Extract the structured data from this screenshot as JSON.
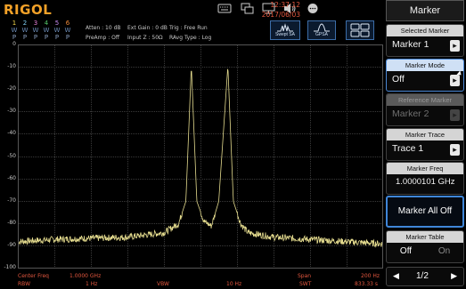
{
  "brand": "RIGOL",
  "traces": [
    {
      "num": "1",
      "color": "#f2d54a",
      "mode": "W",
      "state": "P"
    },
    {
      "num": "2",
      "color": "#7fd0f5",
      "mode": "W",
      "state": "P"
    },
    {
      "num": "3",
      "color": "#e77fd8",
      "mode": "W",
      "state": "P"
    },
    {
      "num": "4",
      "color": "#54c96a",
      "mode": "W",
      "state": "P"
    },
    {
      "num": "5",
      "color": "#c98cf3",
      "mode": "W",
      "state": "P"
    },
    {
      "num": "6",
      "color": "#f28c3a",
      "mode": "W",
      "state": "P"
    }
  ],
  "params": {
    "atten": "Atten : 10 dB",
    "preamp": "PreAmp : Off",
    "ext_gain": "Ext Gain : 0 dB",
    "input": "Input Z : 50Ω",
    "trig": "Trig : Free Run",
    "avg": "RAvg Type : Log"
  },
  "modes": {
    "swept": "Swept SA",
    "gpsa": "GPSA"
  },
  "datetime": {
    "time": "12:37:12",
    "date": "2017/06/03"
  },
  "y_axis": [
    "0",
    "-10",
    "-20",
    "-30",
    "-40",
    "-50",
    "-60",
    "-70",
    "-80",
    "-90",
    "-100"
  ],
  "bottom": {
    "center_label": "Center Freq",
    "center_value": "1.0000 GHz",
    "span_label": "Span",
    "span_value": "200 Hz",
    "rbw_label": "RBW",
    "rbw_value": "1 Hz",
    "vbw_label": "VBW",
    "vbw_value": "10 Hz",
    "swt_label": "SWT",
    "swt_value": "833.33 s"
  },
  "chart_data": {
    "type": "line",
    "ylim": [
      -100,
      0
    ],
    "y_ticks": [
      "0",
      "-10",
      "-20",
      "-30",
      "-40",
      "-50",
      "-60",
      "-70",
      "-80",
      "-90",
      "-100"
    ],
    "series": [
      {
        "color": "#e4db8e",
        "x_fraction": [
          0,
          0.1,
          0.2,
          0.3,
          0.4,
          0.44,
          0.46,
          0.475,
          0.49,
          0.51,
          0.53,
          0.55,
          0.575,
          0.59,
          0.61,
          0.63,
          0.7,
          0.8,
          0.9,
          1.0
        ],
        "values": [
          -88,
          -87,
          -86.5,
          -86,
          -84,
          -80,
          -70,
          -9.5,
          -70,
          -79,
          -81,
          -70,
          -9.5,
          -70,
          -80,
          -84,
          -86,
          -87,
          -88,
          -89
        ]
      }
    ]
  },
  "panel": {
    "title": "Marker",
    "selected_marker": {
      "caption": "Selected Marker",
      "value": "Marker 1"
    },
    "marker_mode": {
      "caption": "Marker Mode",
      "value": "Off"
    },
    "reference_marker": {
      "caption": "Reference Marker",
      "value": "Marker 2"
    },
    "marker_trace": {
      "caption": "Marker Trace",
      "value": "Trace 1"
    },
    "marker_freq": {
      "caption": "Marker Freq",
      "value": "1.0000101 GHz"
    },
    "marker_all_off": "Marker All Off",
    "marker_table": {
      "caption": "Marker Table",
      "off": "Off",
      "on": "On"
    },
    "page": "1/2"
  }
}
